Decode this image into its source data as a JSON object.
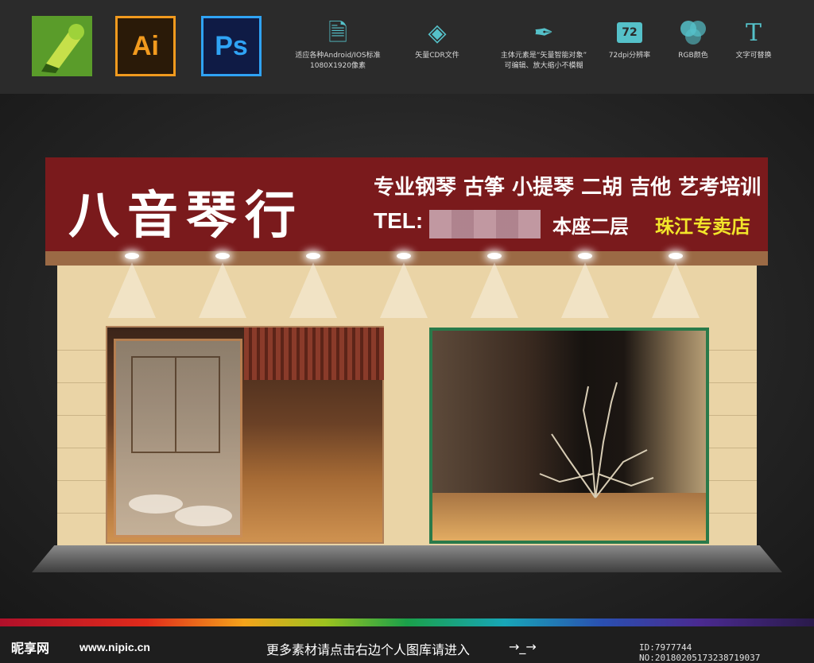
{
  "toolbar": {
    "apps": [
      "Ai",
      "Ps"
    ],
    "features": [
      {
        "icon": "document-icon",
        "glyph": "🗎",
        "lines": [
          "适应各种Android/IOS标准",
          "1080X1920像素"
        ]
      },
      {
        "icon": "layers-icon",
        "glyph": "◈",
        "lines": [
          "矢量CDR文件"
        ]
      },
      {
        "icon": "pen-icon",
        "glyph": "✒",
        "lines": [
          "主体元素是“矢量智能对象”",
          "可编辑、放大缩小不模糊"
        ]
      },
      {
        "icon": "resolution-badge-icon",
        "glyph": "72",
        "lines": [
          "72dpi分辨率"
        ]
      },
      {
        "icon": "rgb-circles-icon",
        "glyph": "⬤",
        "lines": [
          "RGB颜色"
        ]
      },
      {
        "icon": "text-T-icon",
        "glyph": "T",
        "lines": [
          "文字可替换"
        ]
      }
    ]
  },
  "sign": {
    "brand": "八音琴行",
    "services": "专业钢琴 古筝 小提琴 二胡 吉他 艺考培训",
    "tel_label": "TEL:",
    "floor": "本座二层",
    "store_type": "珠江专卖店"
  },
  "footer": {
    "site_brand": "昵享网",
    "url": "www.nipic.cn",
    "more": "更多素材请点击右边个人图库请进入",
    "arrows": "→_→",
    "id_text": "ID:7977744 NO:20180205173238719037"
  },
  "colors": {
    "sign_red": "#7a1a1c",
    "wall": "#ead4a6",
    "service_text": "#ffffff",
    "store_highlight": "#f2e52a"
  }
}
